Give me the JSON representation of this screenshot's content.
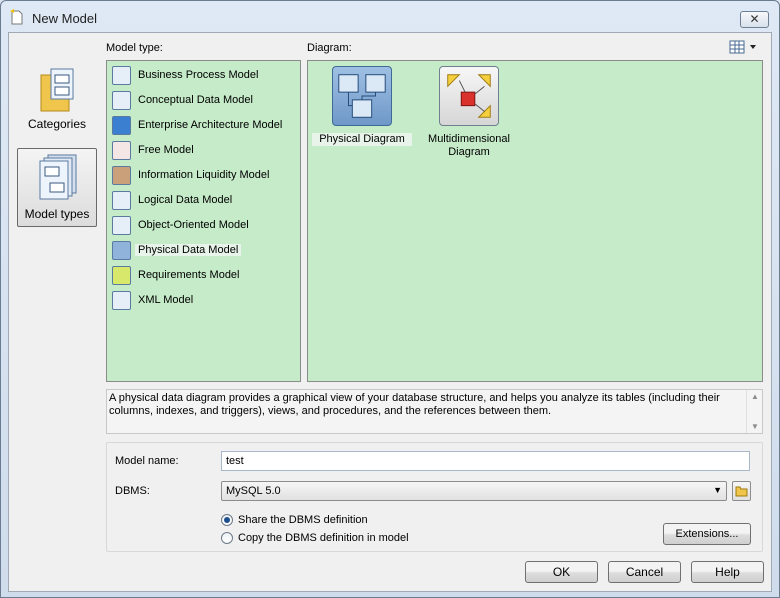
{
  "window": {
    "title": "New Model",
    "close_label": "✕"
  },
  "nav": {
    "categories_label": "Categories",
    "model_types_label": "Model types"
  },
  "model_type_label": "Model type:",
  "diagram_label": "Diagram:",
  "model_types": [
    {
      "label": "Business Process Model"
    },
    {
      "label": "Conceptual Data Model"
    },
    {
      "label": "Enterprise Architecture Model"
    },
    {
      "label": "Free Model"
    },
    {
      "label": "Information Liquidity Model"
    },
    {
      "label": "Logical Data Model"
    },
    {
      "label": "Object-Oriented Model"
    },
    {
      "label": "Physical Data Model"
    },
    {
      "label": "Requirements Model"
    },
    {
      "label": "XML Model"
    }
  ],
  "selected_model_type": "Physical Data Model",
  "diagrams": [
    {
      "label": "Physical Diagram"
    },
    {
      "label": "Multidimensional Diagram"
    }
  ],
  "description": "A physical data diagram provides a graphical view of your database structure, and helps you analyze its tables (including their columns, indexes, and triggers), views, and procedures, and the references between them.",
  "form": {
    "model_name_label": "Model name:",
    "model_name_value": "test",
    "dbms_label": "DBMS:",
    "dbms_value": "MySQL 5.0",
    "radio_share": "Share the DBMS definition",
    "radio_copy": "Copy the DBMS definition in model",
    "extensions_label": "Extensions..."
  },
  "buttons": {
    "ok": "OK",
    "cancel": "Cancel",
    "help": "Help"
  },
  "colors": {
    "panel_bg": "#c6ebc9",
    "accent": "#1e4e8e"
  }
}
